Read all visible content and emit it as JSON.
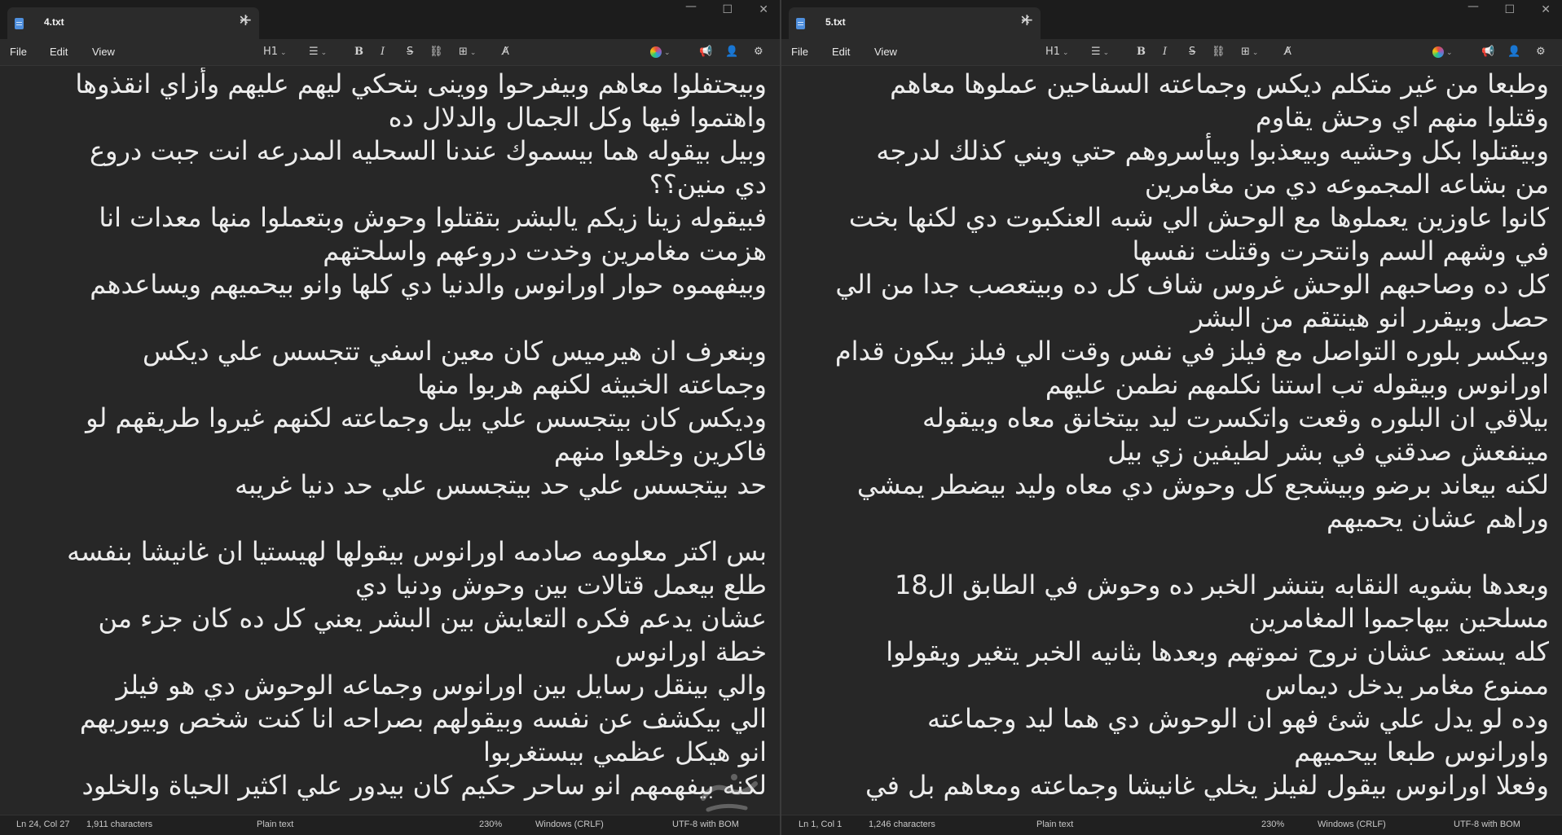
{
  "left": {
    "tab_title": "4.txt",
    "tab_close": "✕",
    "add_tab": "+",
    "window": {
      "min": "—",
      "max": "☐",
      "close": "✕"
    },
    "menu": {
      "file": "File",
      "edit": "Edit",
      "view": "View"
    },
    "toolbar": {
      "heading": "H1",
      "bold": "B",
      "italic": "I",
      "strike": "S"
    },
    "lines": [
      "وبيحتفلوا معاهم وبيفرحوا ووينى بتحكي ليهم عليهم وأزاي انقذوها",
      "واهتموا فيها وكل الجمال والدلال ده",
      "وبيل بيقوله هما بيسموك عندنا السحليه المدرعه انت جبت دروع",
      "دي منين؟؟",
      "فبيقوله زينا زيكم يالبشر بتقتلوا وحوش وبتعملوا منها معدات انا",
      "هزمت مغامرين وخدت دروعهم واسلحتهم",
      "وبيفهموه حوار اورانوس والدنيا دي كلها وانو بيحميهم ويساعدهم",
      "",
      "وبنعرف ان هيرميس كان معين اسفي تتجسس علي ديكس",
      "وجماعته الخبيثه لكنهم هربوا منها",
      "وديكس كان بيتجسس علي بيل وجماعته لكنهم غيروا طريقهم لو",
      "فاكرين وخلعوا منهم",
      "حد بيتجسس علي حد بيتجسس علي حد دنيا غريبه",
      "",
      "بس اكتر معلومه صادمه اورانوس بيقولها لهيستيا ان غانيشا بنفسه",
      "طلع بيعمل قتالات بين وحوش ودنيا دي",
      "عشان يدعم فكره التعايش بين البشر يعني كل ده كان جزء من",
      "خطة اورانوس",
      "والي بينقل رسايل بين اورانوس وجماعه الوحوش دي هو فيلز",
      "الي بيكشف عن نفسه وبيقولهم بصراحه انا كنت شخص وبيوريهم",
      "انو هيكل عظمي بيستغربوا",
      "لكنه بيفهمهم انو ساحر حكيم كان بيدور علي اكثير الحياة والخلود"
    ],
    "status": {
      "position": "Ln 24, Col 27",
      "chars": "1,911 characters",
      "format": "Plain text",
      "zoom": "230%",
      "eol": "Windows (CRLF)",
      "encoding": "UTF-8 with BOM"
    }
  },
  "right": {
    "tab_title": "5.txt",
    "tab_close": "✕",
    "add_tab": "+",
    "window": {
      "min": "—",
      "max": "☐",
      "close": "✕"
    },
    "menu": {
      "file": "File",
      "edit": "Edit",
      "view": "View"
    },
    "toolbar": {
      "heading": "H1",
      "bold": "B",
      "italic": "I",
      "strike": "S"
    },
    "lines": [
      "وطبعا من غير متكلم ديكس وجماعته السفاحين عملوها معاهم",
      "وقتلوا منهم اي وحش يقاوم",
      "وبيقتلوا بكل وحشيه وبيعذبوا وبيأسروهم حتي ويني كذلك لدرجه",
      "من بشاعه المجموعه دي من مغامرين",
      "كانوا عاوزين يعملوها مع الوحش الي شبه العنكبوت دي لكنها بخت",
      "في وشهم السم وانتحرت وقتلت نفسها",
      "كل ده وصاحبهم الوحش غروس شاف كل ده وبيتعصب جدا من الي",
      "حصل وبيقرر انو هينتقم من البشر",
      "وبيكسر بلوره التواصل مع فيلز في نفس وقت الي فيلز بيكون قدام",
      "اورانوس وبيقوله تب استنا نكلمهم نطمن عليهم",
      "بيلاقي ان البلوره وقعت واتكسرت ليد بيتخانق معاه وبيقوله",
      "مينفعش صدقني في بشر لطيفين زي بيل",
      "لكنه بيعاند برضو وبيشجع كل وحوش دي معاه وليد بيضطر يمشي",
      "وراهم عشان يحميهم",
      "",
      "وبعدها بشويه النقابه بتنشر الخبر ده وحوش في الطابق ال18",
      "مسلحين بيهاجموا المغامرين",
      "كله يستعد عشان نروح نموتهم وبعدها بثانيه الخبر يتغير ويقولوا",
      "ممنوع مغامر يدخل ديماس",
      "وده لو يدل علي شئ فهو ان الوحوش دي هما ليد وجماعته",
      "واورانوس طبعا بيحميهم",
      "وفعلا اورانوس بيقول لفيلز يخلي غانيشا وجماعته ومعاهم بل في"
    ],
    "status": {
      "position": "Ln 1, Col 1",
      "chars": "1,246 characters",
      "format": "Plain text",
      "zoom": "230%",
      "eol": "Windows (CRLF)",
      "encoding": "UTF-8 with BOM"
    }
  },
  "watermark": "مستقل"
}
